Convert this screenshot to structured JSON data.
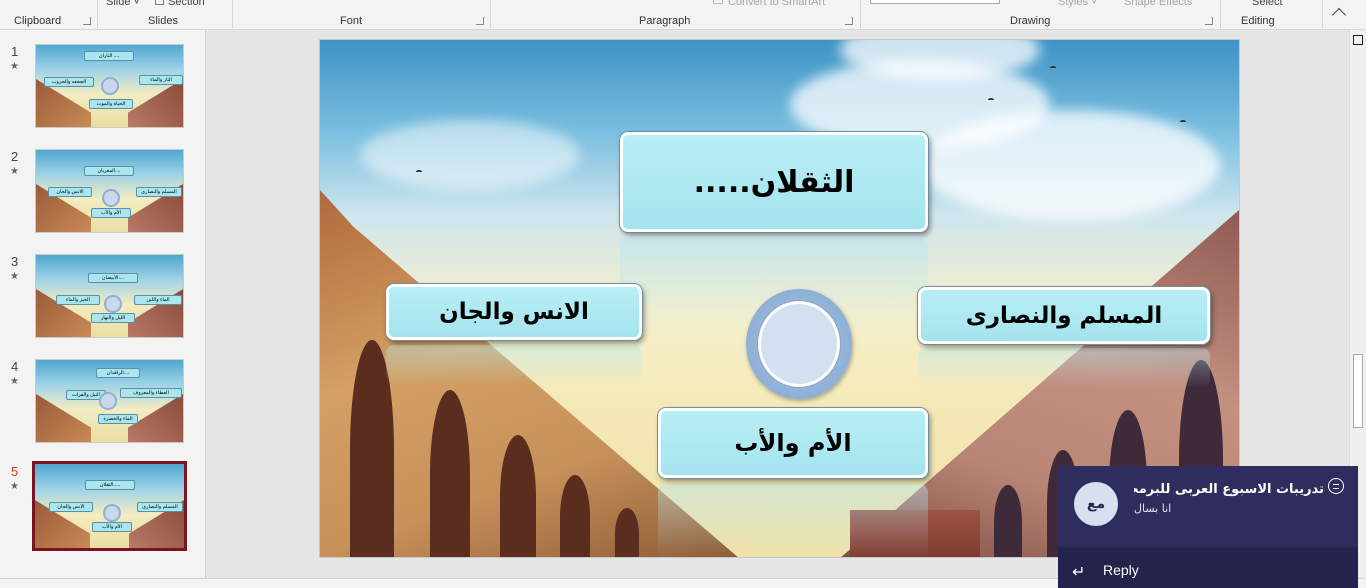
{
  "ribbon": {
    "groups": {
      "clipboard": "Clipboard",
      "slides": "Slides",
      "font": "Font",
      "paragraph": "Paragraph",
      "drawing": "Drawing",
      "editing": "Editing"
    },
    "slide_btn": "Slide ˅",
    "section_btn": "Section",
    "smartart_btn": "Convert to SmartArt",
    "styles_btn": "Styles ˅",
    "shape_effects_btn": "Shape Effects",
    "select_btn": "Select"
  },
  "thumbnails": [
    {
      "number": "1",
      "star": "★",
      "texts": [
        "الناران ....",
        "النار والماء",
        "الجخعه والحروب",
        "الحياة والموت"
      ]
    },
    {
      "number": "2",
      "star": "★",
      "texts": [
        "المغربان....",
        "المسلم والنصارى",
        "الانس والجان",
        "الأم والأب"
      ]
    },
    {
      "number": "3",
      "star": "★",
      "texts": [
        "الأبيضان....",
        "الماء واللبن",
        "الخبز والماء",
        "الليل والنهار"
      ]
    },
    {
      "number": "4",
      "star": "★",
      "texts": [
        "الرافدان....",
        "العطاء والمعروف",
        "النيل والفرات",
        "الماء والخضرة"
      ]
    },
    {
      "number": "5",
      "star": "★",
      "texts": [
        "الثقلان.....",
        "المسلم والنصارى",
        "الانس والجان",
        "الأم والأب"
      ]
    }
  ],
  "slide": {
    "title": "الثقلان.....",
    "right_box": "المسلم والنصارى",
    "left_box": "الانس والجان",
    "bottom_box": "الأم والأب"
  },
  "notification": {
    "avatar_initials": "مع",
    "title": "تدريبات الاسبوع العربى للبرمجه)...",
    "subtitle": "انا بسال",
    "reply_label": "Reply",
    "reply_icon": "↵"
  },
  "colors": {
    "ribbon_bg": "#f3f3f3",
    "active_slide_border": "#7a1420",
    "active_slide_number": "#c43e1c",
    "box_fill": "#a4e4ef",
    "toast_bg": "#2f2d5e"
  }
}
